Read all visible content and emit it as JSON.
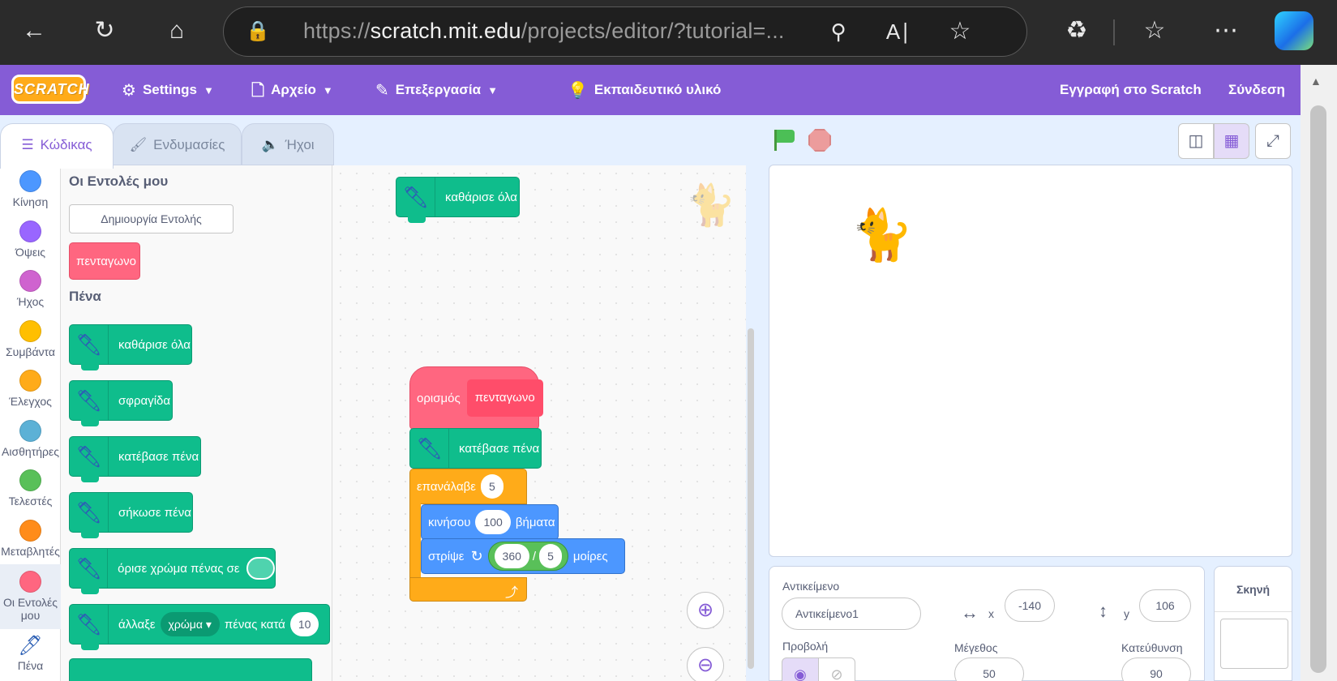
{
  "browser": {
    "url_scheme": "https://",
    "url_host": "scratch.mit.edu",
    "url_path": "/projects/editor/?tutorial=..."
  },
  "menubar": {
    "logo": "SCRATCH",
    "settings": "Settings",
    "file": "Αρχείο",
    "edit": "Επεξεργασία",
    "tutorials": "Εκπαιδευτικό υλικό",
    "join": "Εγγραφή στο Scratch",
    "signin": "Σύνδεση"
  },
  "tabs": {
    "code": "Κώδικας",
    "costumes": "Ενδυμασίες",
    "sounds": "Ήχοι"
  },
  "categories": [
    {
      "label": "Κίνηση",
      "color": "#4c97ff"
    },
    {
      "label": "Όψεις",
      "color": "#9966ff"
    },
    {
      "label": "Ήχος",
      "color": "#cf63cf"
    },
    {
      "label": "Συμβάντα",
      "color": "#ffbf00"
    },
    {
      "label": "Έλεγχος",
      "color": "#ffab19"
    },
    {
      "label": "Αισθητήρες",
      "color": "#5cb1d6"
    },
    {
      "label": "Τελεστές",
      "color": "#59c059"
    },
    {
      "label": "Μεταβλητές",
      "color": "#ff8c1a"
    },
    {
      "label": "Οι Εντολές μου",
      "color": "#ff6680"
    },
    {
      "label": "Πένα",
      "color": "#0fbd8c"
    }
  ],
  "palette": {
    "my_blocks_heading": "Οι Εντολές μου",
    "make_block": "Δημιουργία Εντολής",
    "custom_block": "πενταγωνο",
    "pen_heading": "Πένα",
    "pen_blocks": {
      "erase_all": "καθάρισε όλα",
      "stamp": "σφραγίδα",
      "pen_down": "κατέβασε πένα",
      "pen_up": "σήκωσε πένα",
      "set_color": "όρισε χρώμα πένας σε",
      "change_prefix": "άλλαξε",
      "change_dropdown": "χρώμα",
      "change_suffix": "πένας κατά",
      "change_value": "10"
    }
  },
  "script": {
    "erase_all": "καθάρισε όλα",
    "define": "ορισμός",
    "define_name": "πενταγωνο",
    "pen_down": "κατέβασε πένα",
    "repeat": "επανάλαβε",
    "repeat_count": "5",
    "move": "κινήσου",
    "move_steps": "100",
    "move_suffix": "βήματα",
    "turn": "στρίψε",
    "turn_a": "360",
    "turn_op": "/",
    "turn_b": "5",
    "turn_suffix": "μοίρες"
  },
  "sprite_info": {
    "sprite_label": "Αντικείμενο",
    "sprite_name": "Αντικείμενο1",
    "x_label": "x",
    "x_value": "-140",
    "y_label": "y",
    "y_value": "106",
    "show_label": "Προβολή",
    "size_label": "Μέγεθος",
    "size_value": "50",
    "direction_label": "Κατεύθυνση",
    "direction_value": "90"
  },
  "stage_panel": {
    "title": "Σκηνή"
  }
}
